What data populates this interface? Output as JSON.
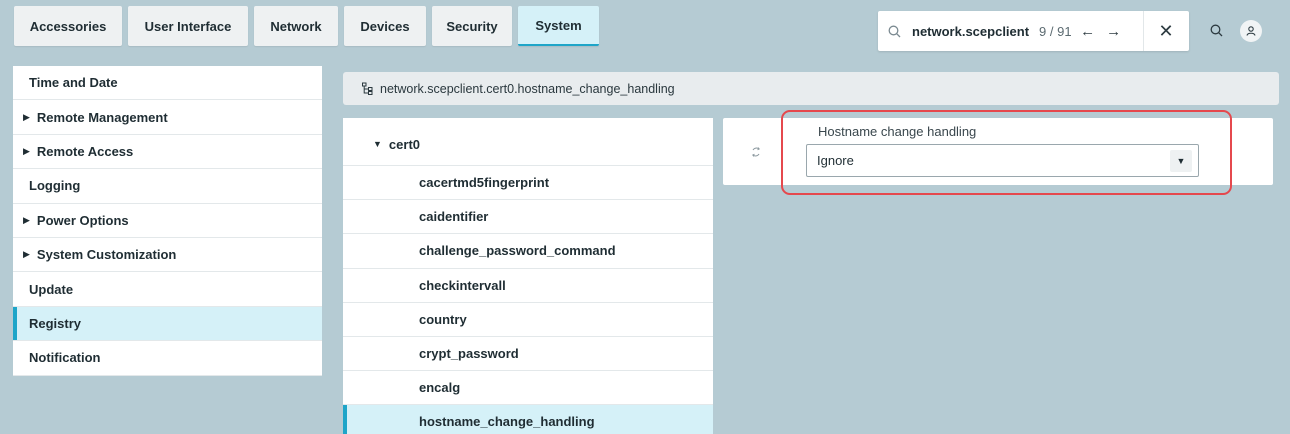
{
  "tabs": [
    {
      "label": "Accessories"
    },
    {
      "label": "User Interface"
    },
    {
      "label": "Network"
    },
    {
      "label": "Devices"
    },
    {
      "label": "Security"
    },
    {
      "label": "System"
    }
  ],
  "active_tab": "System",
  "search": {
    "query": "network.scepclient",
    "count": "9 / 91",
    "prev_icon": "←",
    "next_icon": "→",
    "close_icon": "✕"
  },
  "sidebar": {
    "items": [
      {
        "label": "Time and Date"
      },
      {
        "label": "Remote Management"
      },
      {
        "label": "Remote Access"
      },
      {
        "label": "Logging"
      },
      {
        "label": "Power Options"
      },
      {
        "label": "System Customization"
      },
      {
        "label": "Update"
      },
      {
        "label": "Registry"
      },
      {
        "label": "Notification"
      }
    ]
  },
  "breadcrumb": {
    "path": "network.scepclient.cert0.hostname_change_handling"
  },
  "tree": {
    "parent": "cert0",
    "items": [
      {
        "label": "cacertmd5fingerprint"
      },
      {
        "label": "caidentifier"
      },
      {
        "label": "challenge_password_command"
      },
      {
        "label": "checkintervall"
      },
      {
        "label": "country"
      },
      {
        "label": "crypt_password"
      },
      {
        "label": "encalg"
      },
      {
        "label": "hostname_change_handling"
      }
    ]
  },
  "setting": {
    "label": "Hostname change handling",
    "value": "Ignore"
  },
  "colors": {
    "accent": "#1ea5c8",
    "active_bg": "#d5f1f8",
    "highlight": "#e5484d",
    "background": "#b5cbd3"
  }
}
